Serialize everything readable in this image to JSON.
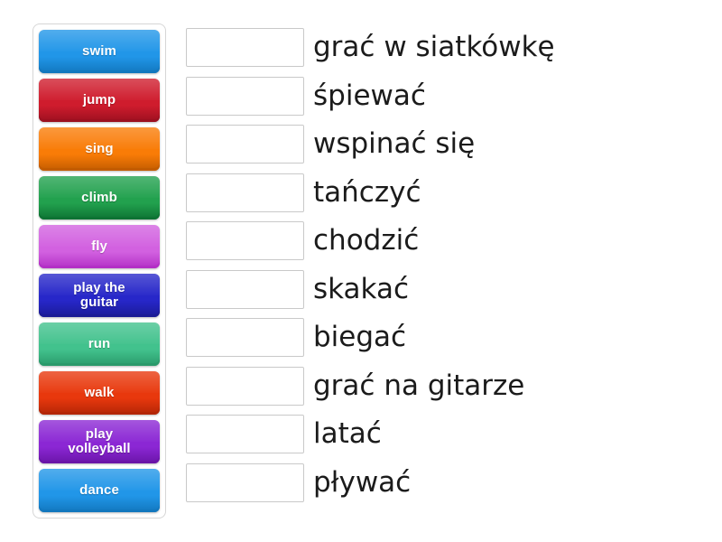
{
  "exercise": {
    "type": "match-up",
    "tile_panel": {
      "name": "word-bank",
      "tiles": [
        {
          "label": "swim",
          "color": "#2196e8",
          "color_dark": "#1277be"
        },
        {
          "label": "jump",
          "color": "#cf1c2d",
          "color_dark": "#9c1020"
        },
        {
          "label": "sing",
          "color": "#f97c07",
          "color_dark": "#c25c00"
        },
        {
          "label": "climb",
          "color": "#22a14e",
          "color_dark": "#0d7333"
        },
        {
          "label": "fly",
          "color": "#d261e0",
          "color_dark": "#b32fc6"
        },
        {
          "label": "play the\nguitar",
          "color": "#2727c9",
          "color_dark": "#1b1b96"
        },
        {
          "label": "run",
          "color": "#42c28d",
          "color_dark": "#2a9a6b"
        },
        {
          "label": "walk",
          "color": "#e8380d",
          "color_dark": "#b32606"
        },
        {
          "label": "play\nvolleyball",
          "color": "#8b27d4",
          "color_dark": "#6a14a8"
        },
        {
          "label": "dance",
          "color": "#2196e8",
          "color_dark": "#1277be"
        }
      ]
    },
    "answers": {
      "name": "answer-list",
      "drop_box_placeholder": "",
      "rows": [
        {
          "drop_value": "",
          "prompt": "grać w siatkówkę"
        },
        {
          "drop_value": "",
          "prompt": "śpiewać"
        },
        {
          "drop_value": "",
          "prompt": "wspinać się"
        },
        {
          "drop_value": "",
          "prompt": "tańczyć"
        },
        {
          "drop_value": "",
          "prompt": "chodzić"
        },
        {
          "drop_value": "",
          "prompt": "skakać"
        },
        {
          "drop_value": "",
          "prompt": "biegać"
        },
        {
          "drop_value": "",
          "prompt": "grać na gitarze"
        },
        {
          "drop_value": "",
          "prompt": "latać"
        },
        {
          "drop_value": "",
          "prompt": "pływać"
        }
      ]
    }
  }
}
